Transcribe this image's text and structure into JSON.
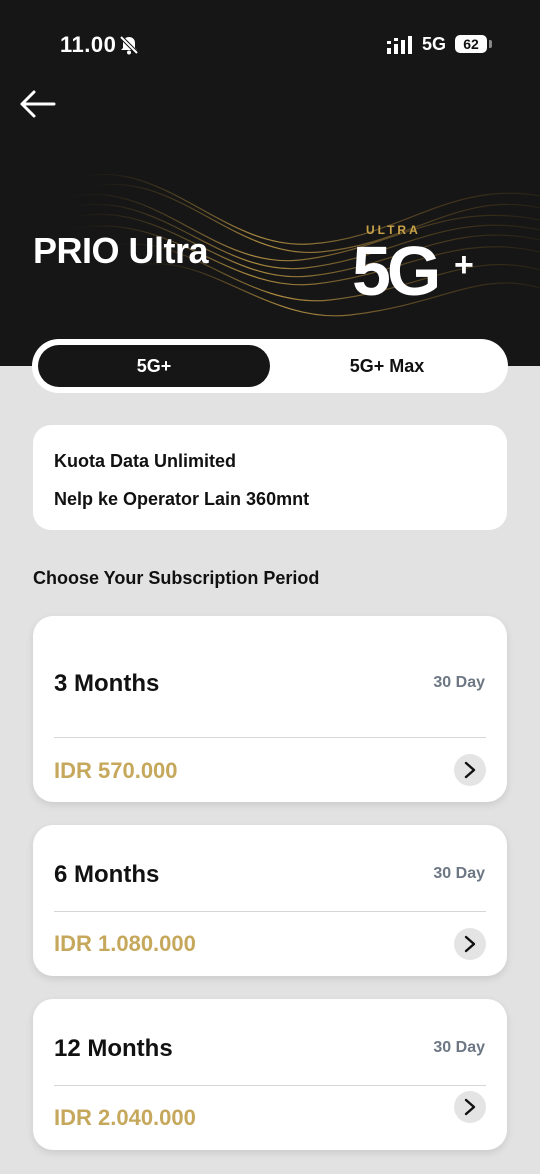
{
  "status_bar": {
    "time": "11.00",
    "network": "5G",
    "battery": "62"
  },
  "header": {
    "title": "PRIO Ultra",
    "logo_top": "ULTRA",
    "logo_main": "5G",
    "logo_plus": "+"
  },
  "tabs": [
    {
      "label": "5G+",
      "active": true
    },
    {
      "label": "5G+ Max",
      "active": false
    }
  ],
  "features": [
    "Kuota Data Unlimited",
    "Nelp ke Operator Lain 360mnt"
  ],
  "section_title": "Choose Your Subscription Period",
  "plans": [
    {
      "name": "3 Months",
      "days": "30 Day",
      "price": "IDR 570.000"
    },
    {
      "name": "6 Months",
      "days": "30 Day",
      "price": "IDR 1.080.000"
    },
    {
      "name": "12 Months",
      "days": "30 Day",
      "price": "IDR 2.040.000"
    }
  ],
  "colors": {
    "header_bg": "#161616",
    "page_bg": "#e2e2e2",
    "price_gold": "#c6a85c",
    "days_gray": "#6d7784"
  }
}
